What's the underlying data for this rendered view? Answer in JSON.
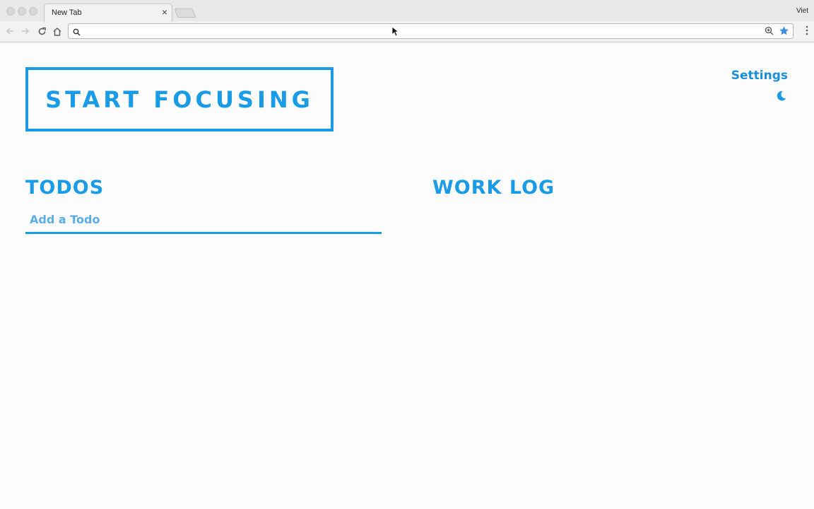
{
  "browser": {
    "tab_title": "New Tab",
    "tab_close": "×",
    "profile_name": "Viet",
    "address_value": "",
    "address_placeholder": ""
  },
  "app": {
    "focus_button_label": "START FOCUSING",
    "settings_label": "Settings",
    "theme_toggle_icon": "moon-icon",
    "todos": {
      "title": "TODOS",
      "input_placeholder": "Add a Todo",
      "items": []
    },
    "work_log": {
      "title": "WORK LOG",
      "entries": []
    }
  },
  "colors": {
    "accent": "#1a9be6",
    "background": "#fcfcfc"
  }
}
